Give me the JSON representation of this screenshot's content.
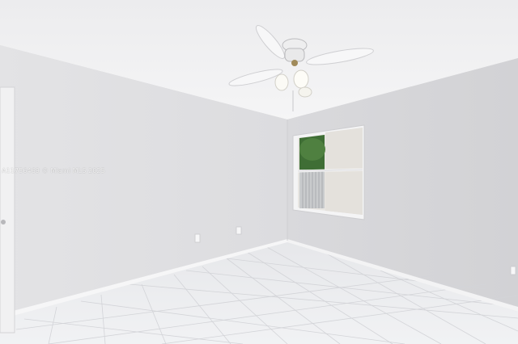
{
  "photo": {
    "subject": "empty-room-with-ceiling-fan-and-window",
    "watermark_text": "A11756469 © Miami MLS 2025",
    "colors": {
      "ceiling": "#f2f2f3",
      "left_wall": "#e0e0e2",
      "right_wall": "#d6d6d9",
      "floor": "#ecedf0",
      "trim": "#f7f7f8",
      "window_frame": "#f4f4f5",
      "greenery": "#3f6e35"
    }
  }
}
